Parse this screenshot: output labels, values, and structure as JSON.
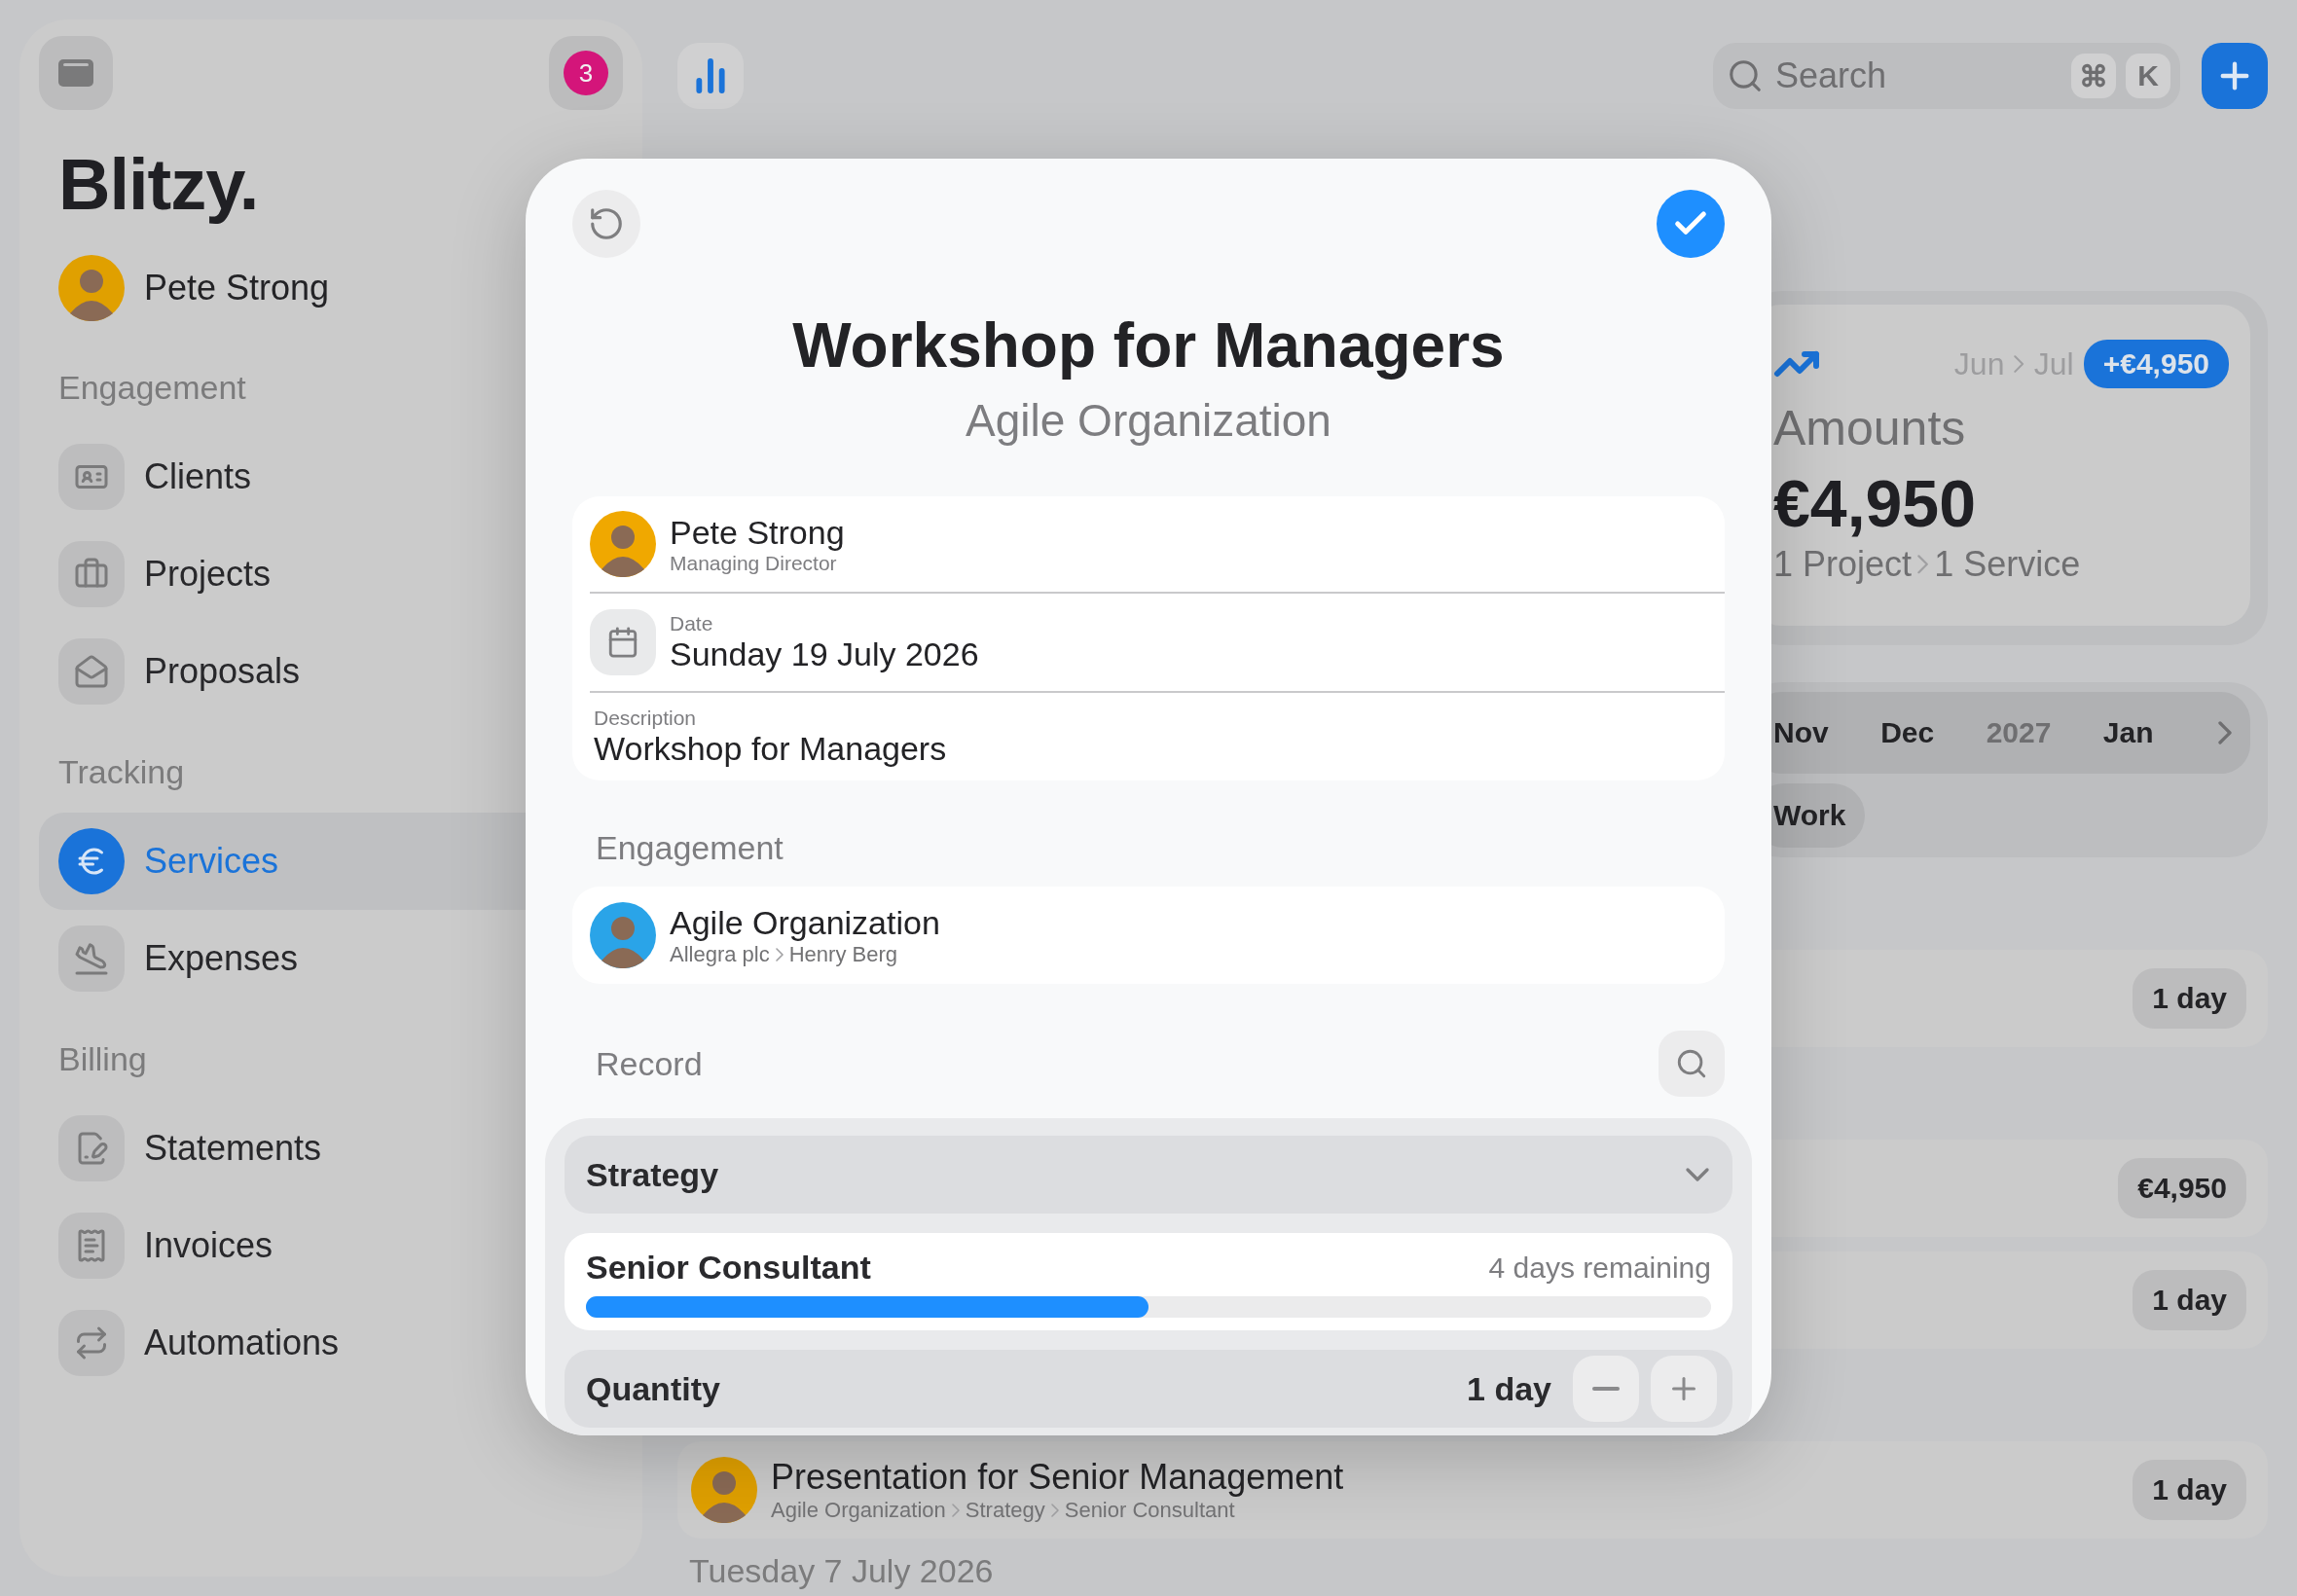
{
  "sidebar": {
    "notification_count": "3",
    "logo": "Blitzy.",
    "user": {
      "name": "Pete Strong"
    },
    "sections": [
      {
        "title": "Engagement",
        "items": [
          {
            "label": "Clients",
            "selected": false
          },
          {
            "label": "Projects",
            "selected": false
          },
          {
            "label": "Proposals",
            "selected": false
          }
        ]
      },
      {
        "title": "Tracking",
        "items": [
          {
            "label": "Services",
            "selected": true
          },
          {
            "label": "Expenses",
            "selected": false
          }
        ]
      },
      {
        "title": "Billing",
        "items": [
          {
            "label": "Statements",
            "selected": false
          },
          {
            "label": "Invoices",
            "selected": false
          },
          {
            "label": "Automations",
            "selected": false
          }
        ]
      }
    ]
  },
  "toolbar": {
    "search": {
      "placeholder": "Search",
      "shortcut_keys": [
        "⌘",
        "K"
      ]
    }
  },
  "summary_card": {
    "period_from": "Jun",
    "period_to": "Jul",
    "change": "+€4,950",
    "title": "Amounts",
    "total": "€4,950",
    "projects": "1 Project",
    "services": "1 Service"
  },
  "month_strip": {
    "items": [
      {
        "label": "Nov",
        "kind": "month"
      },
      {
        "label": "Dec",
        "kind": "month"
      },
      {
        "label": "2027",
        "kind": "year"
      },
      {
        "label": "Jan",
        "kind": "month"
      }
    ],
    "filter_chip": "Work"
  },
  "list_rows": [
    {
      "badge": "1 day"
    },
    {
      "badge": "€4,950"
    },
    {
      "badge": "1 day"
    },
    {
      "title": "Presentation for Senior Management",
      "path": [
        "Agile Organization",
        "Strategy",
        "Senior Consultant"
      ],
      "badge": "1 day"
    }
  ],
  "list_date_heading": "Tuesday 7 July 2026",
  "modal": {
    "title": "Workshop for Managers",
    "subtitle": "Agile Organization",
    "person": {
      "name": "Pete Strong",
      "role": "Managing Director"
    },
    "date": {
      "label": "Date",
      "value": "Sunday 19 July 2026"
    },
    "description": {
      "label": "Description",
      "value": "Workshop for Managers"
    },
    "engagement": {
      "heading": "Engagement",
      "name": "Agile Organization",
      "path": [
        "Allegra plc",
        "Henry Berg"
      ]
    },
    "record": {
      "heading": "Record",
      "category": "Strategy",
      "role": {
        "label": "Senior Consultant",
        "remaining": "4 days remaining",
        "level": 0.5
      },
      "quantity": {
        "label": "Quantity",
        "value": "1 day"
      }
    }
  }
}
